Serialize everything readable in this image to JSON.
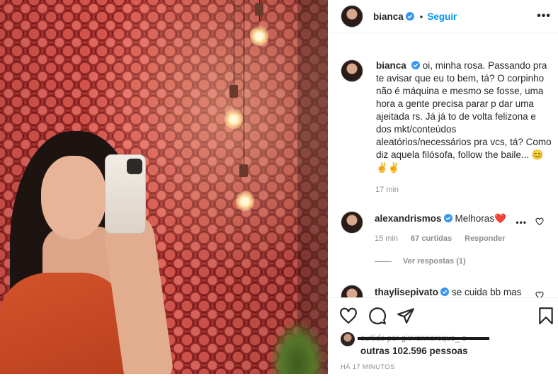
{
  "post": {
    "author": "bianca",
    "follow_label": "Seguir",
    "dot": "•",
    "more_label": "•••"
  },
  "caption": {
    "author": "bianca",
    "text": "oi, minha rosa. Passando pra te avisar que eu to bem, tá? O corpinho não é máquina e mesmo se fosse, uma hora a gente precisa parar p dar uma ajeitada rs. Já já to de volta felizona e dos mkt/conteúdos aleatórios/necessários pra vcs, tá? Como diz aquela filósofa, follow the baile... 😊✌️✌️",
    "time": "17 min"
  },
  "comments": [
    {
      "author": "alexandrismos",
      "text": "Melhoras❤️",
      "time": "15 min",
      "likes": "67 curtidas",
      "reply": "Responder",
      "dots": "•••"
    },
    {
      "author": "thaylisepivato",
      "text": "se cuida bb mas"
    }
  ],
  "view_replies": "Ver respostas (1)",
  "likes": {
    "prefix": "curtido por giovannaroque_ e",
    "others": "outras 102.596 pessoas"
  },
  "posted_ago": "HÁ 17 MINUTOS",
  "icons": {
    "like": "heart-icon",
    "comment": "comment-icon",
    "share": "send-icon",
    "save": "bookmark-icon",
    "verified": "verified-badge-icon"
  },
  "colors": {
    "accent": "#0095f6",
    "verified": "#3897f0",
    "heart": "#ed4956"
  }
}
